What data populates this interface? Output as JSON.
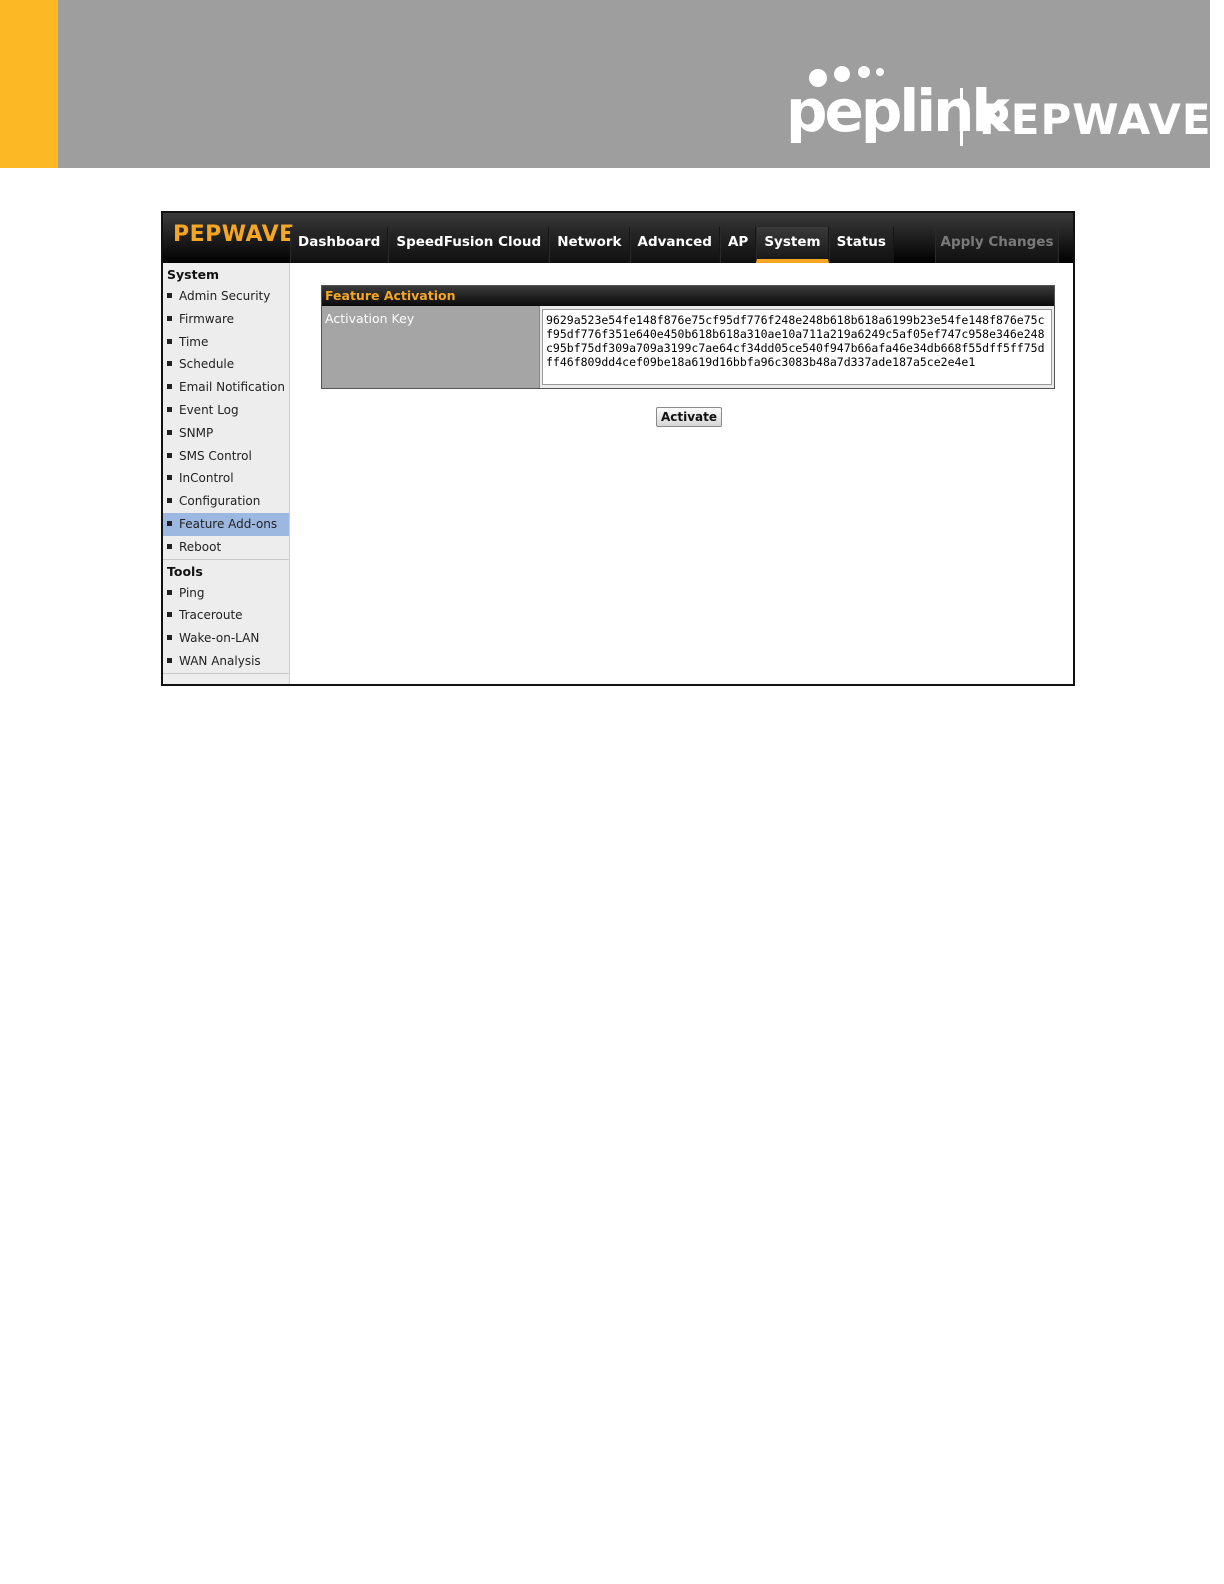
{
  "brand": {
    "company_name": "peplink",
    "product_name": "PEPWAVE",
    "accent_color": "#fdb924"
  },
  "app": {
    "logo": "PEPWAVE",
    "nav_tabs": [
      {
        "label": "Dashboard",
        "active": false
      },
      {
        "label": "SpeedFusion Cloud",
        "active": false
      },
      {
        "label": "Network",
        "active": false
      },
      {
        "label": "Advanced",
        "active": false
      },
      {
        "label": "AP",
        "active": false
      },
      {
        "label": "System",
        "active": true
      },
      {
        "label": "Status",
        "active": false
      }
    ],
    "apply_changes": "Apply Changes"
  },
  "sidebar": {
    "system_heading": "System",
    "system_items": [
      {
        "label": "Admin Security"
      },
      {
        "label": "Firmware"
      },
      {
        "label": "Time"
      },
      {
        "label": "Schedule"
      },
      {
        "label": "Email Notification"
      },
      {
        "label": "Event Log"
      },
      {
        "label": "SNMP"
      },
      {
        "label": "SMS Control"
      },
      {
        "label": "InControl"
      },
      {
        "label": "Configuration"
      },
      {
        "label": "Feature Add-ons",
        "active": true
      },
      {
        "label": "Reboot"
      }
    ],
    "tools_heading": "Tools",
    "tools_items": [
      {
        "label": "Ping"
      },
      {
        "label": "Traceroute"
      },
      {
        "label": "Wake-on-LAN"
      },
      {
        "label": "WAN Analysis"
      }
    ]
  },
  "panel": {
    "title": "Feature Activation",
    "activation_key_label": "Activation Key",
    "activation_key_value": "9629a523e54fe148f876e75cf95df776f248e248b618b618a6199b23e54fe148f876e75cf95df776f351e640e450b618b618a310ae10a711a219a6249c5af05ef747c958e346e248c95bf75df309a709a3199c7ae64cf34dd05ce540f947b66afa46e34db668f55dff5ff75dff46f809dd4cef09be18a619d16bbfa96c3083b48a7d337ade187a5ce2e4e1",
    "activate_button": "Activate"
  }
}
